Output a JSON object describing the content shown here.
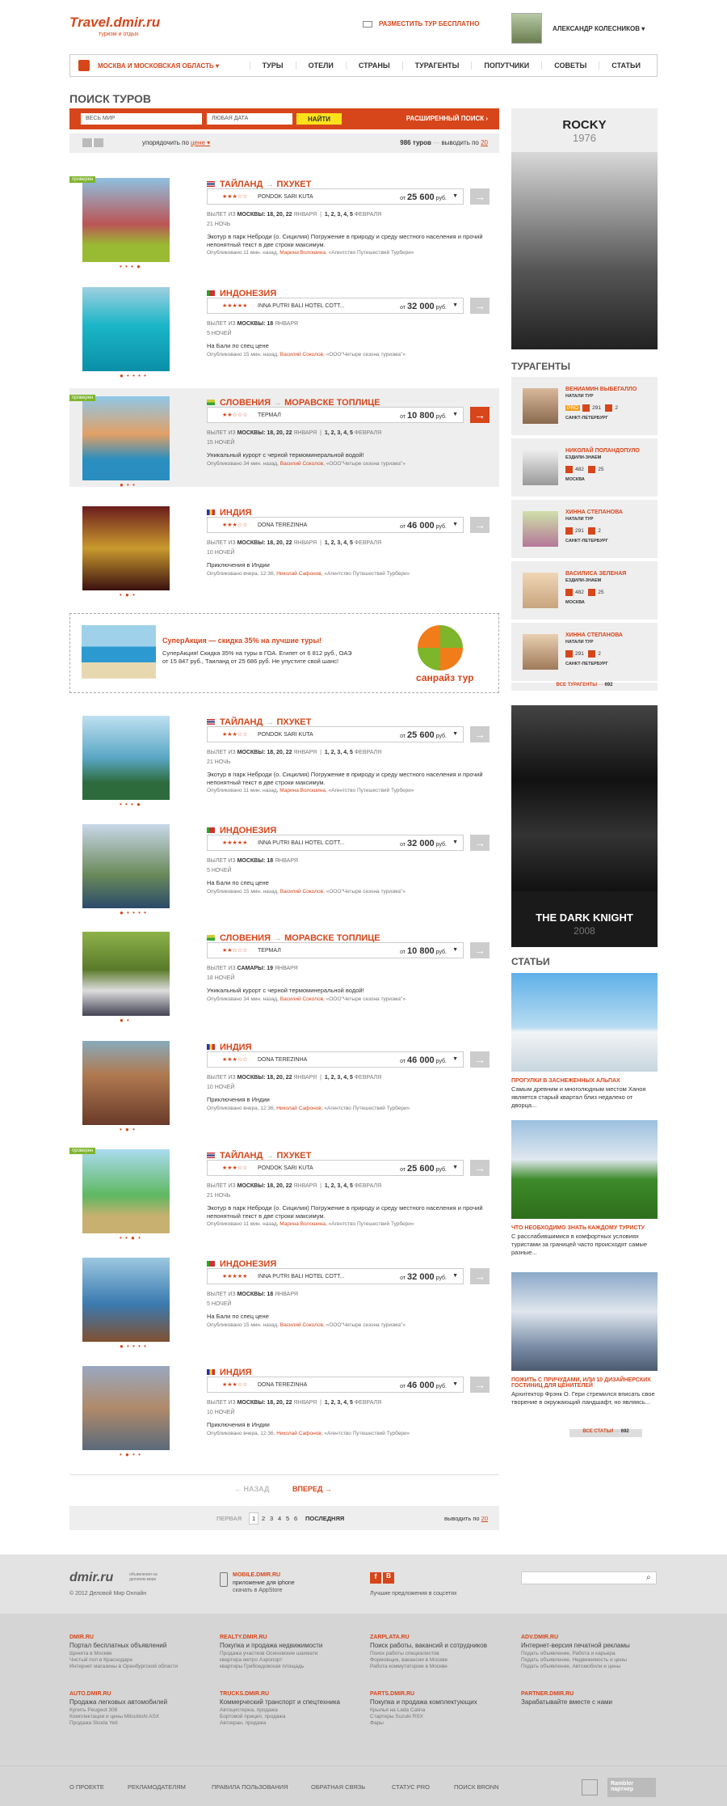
{
  "header": {
    "logo": "Travel.dmir.ru",
    "slogan": "туризм и отдых",
    "place_tour": "РАЗМЕСТИТЬ ТУР БЕСПЛАТНО",
    "user_name": "АЛЕКСАНДР КОЛЕСНИКОВ ▾"
  },
  "nav": {
    "region": "МОСКВА И МОСКОВСКАЯ ОБЛАСТЬ ▾",
    "items": [
      "ТУРЫ",
      "ОТЕЛИ",
      "СТРАНЫ",
      "ТУРАГЕНТЫ",
      "ПОПУТЧИКИ",
      "СОВЕТЫ",
      "СТАТЬИ"
    ]
  },
  "search": {
    "title": "ПОИСК ТУРОВ",
    "where": "ВЕСЬ МИР",
    "date": "ЛЮБАЯ ДАТА",
    "find": "НАЙТИ",
    "advanced": "РАСШИРЕННЫЙ ПОИСК ›",
    "sort_label": "упорядочить по",
    "sort_value": "цене ▾",
    "count": "986 туров",
    "per_page_label": "выводить по",
    "per_page": "20"
  },
  "tours": [
    {
      "badge": "проверен",
      "dots": "• • • ●",
      "country": "ТАЙЛАНД",
      "city": "ПХУКЕТ",
      "stars": "★★★☆☆",
      "hotel": "PONDOK SARI KUTA",
      "price_from": "от",
      "price": "25 600",
      "cur": "руб.",
      "dep_label": "ВЫЛЕТ ИЗ",
      "dep_city": "МОСКВЫ:",
      "dep_jan": "18, 20, 22",
      "jan": "ЯНВАРЯ",
      "dep_feb": "1, 2, 3, 4, 5",
      "feb": "ФЕВРАЛЯ",
      "nights": "21 НОЧЬ",
      "desc": "Экотур в парк Неброди (о. Сицилия) Погружение в природу и среду местного населения и прочий непонятный текст в две строки максимум.",
      "pub": "Опубликовано 11 мин. назад,",
      "author": "Марина Волошина,",
      "agency": "«Агентство Путешествий Турбери»"
    },
    {
      "badge": "",
      "dots": "● • • • •",
      "country": "ИНДОНЕЗИЯ",
      "city": "",
      "stars": "★★★★★",
      "hotel": "INNA PUTRI BALI HOTEL COTT...",
      "price_from": "от",
      "price": "32 000",
      "cur": "руб.",
      "dep_label": "ВЫЛЕТ ИЗ",
      "dep_city": "МОСКВЫ:",
      "dep_jan": "18",
      "jan": "ЯНВАРЯ",
      "dep_feb": "",
      "feb": "",
      "nights": "5 НОЧЕЙ",
      "desc": "На Бали по спец цене",
      "pub": "Опубликовано 15 мин. назад,",
      "author": "Василий Соколов,",
      "agency": "«ООО\"Четыре сезона туризма\"»"
    },
    {
      "badge": "проверен",
      "dots": "● • •",
      "country": "СЛОВЕНИЯ",
      "city": "МОРАВСКЕ ТОПЛИЦЕ",
      "stars": "★★☆☆☆",
      "hotel": "ТЕРМАЛ",
      "price_from": "от",
      "price": "10 800",
      "cur": "руб.",
      "dep_label": "ВЫЛЕТ ИЗ",
      "dep_city": "МОСКВЫ:",
      "dep_jan": "18, 20, 22",
      "jan": "ЯНВАРЯ",
      "dep_feb": "1, 2, 3, 4, 5",
      "feb": "ФЕВРАЛЯ",
      "nights": "15 НОЧЕЙ",
      "desc": "Уникальный курорт с черной термоминеральной водой!",
      "pub": "Опубликовано 34 мин. назад,",
      "author": "Василий Соколов,",
      "agency": "«ООО\"Четыре сезона туризма\"»"
    },
    {
      "badge": "",
      "dots": "• ● •",
      "country": "ИНДИЯ",
      "city": "",
      "stars": "★★★☆☆",
      "hotel": "DONA TEREZINHA",
      "price_from": "от",
      "price": "46 000",
      "cur": "руб.",
      "dep_label": "ВЫЛЕТ ИЗ",
      "dep_city": "МОСКВЫ:",
      "dep_jan": "18, 20, 22",
      "jan": "ЯНВАРЯ",
      "dep_feb": "1, 2, 3, 4, 5",
      "feb": "ФЕВРАЛЯ",
      "nights": "10 НОЧЕЙ",
      "desc": "Приключения в Индии",
      "pub": "Опубликовано вчера, 12:36,",
      "author": "Николай Сафонов,",
      "agency": "«Агентство Путешествий Турбери»"
    },
    {
      "badge": "",
      "dots": "• • • ●",
      "country": "ТАЙЛАНД",
      "city": "ПХУКЕТ",
      "stars": "★★★☆☆",
      "hotel": "PONDOK SARI KUTA",
      "price_from": "от",
      "price": "25 600",
      "cur": "руб.",
      "dep_label": "ВЫЛЕТ ИЗ",
      "dep_city": "МОСКВЫ:",
      "dep_jan": "18, 20, 22",
      "jan": "ЯНВАРЯ",
      "dep_feb": "1, 2, 3, 4, 5",
      "feb": "ФЕВРАЛЯ",
      "nights": "21 НОЧЬ",
      "desc": "Экотур в парк Неброди (о. Сицилия) Погружение в природу и среду местного населения и прочий непонятный текст в две строки максимум.",
      "pub": "Опубликовано 11 мин. назад,",
      "author": "Марина Волошина,",
      "agency": "«Агентство Путешествий Турбери»"
    },
    {
      "badge": "",
      "dots": "● • • • •",
      "country": "ИНДОНЕЗИЯ",
      "city": "",
      "stars": "★★★★★",
      "hotel": "INNA PUTRI BALI HOTEL COTT...",
      "price_from": "от",
      "price": "32 000",
      "cur": "руб.",
      "dep_label": "ВЫЛЕТ ИЗ",
      "dep_city": "МОСКВЫ:",
      "dep_jan": "18",
      "jan": "ЯНВАРЯ",
      "dep_feb": "",
      "feb": "",
      "nights": "5 НОЧЕЙ",
      "desc": "На Бали по спец цене",
      "pub": "Опубликовано 15 мин. назад,",
      "author": "Василий Соколов,",
      "agency": "«ООО\"Четыре сезона туризма\"»"
    },
    {
      "badge": "",
      "dots": "● •",
      "country": "СЛОВЕНИЯ",
      "city": "МОРАВСКЕ ТОПЛИЦЕ",
      "stars": "★★☆☆☆",
      "hotel": "ТЕРМАЛ",
      "price_from": "от",
      "price": "10 800",
      "cur": "руб.",
      "dep_label": "ВЫЛЕТ ИЗ",
      "dep_city": "САМАРЫ:",
      "dep_jan": "19",
      "jan": "ЯНВАРЯ",
      "dep_feb": "",
      "feb": "",
      "nights": "18 НОЧЕЙ",
      "desc": "Уникальный курорт с черной термоминеральной водой!",
      "pub": "Опубликовано 34 мин. назад,",
      "author": "Василий Соколов,",
      "agency": "«ООО\"Четыре сезона туризма\"»"
    },
    {
      "badge": "",
      "dots": "• ● •",
      "country": "ИНДИЯ",
      "city": "",
      "stars": "★★★☆☆",
      "hotel": "DONA TEREZINHA",
      "price_from": "от",
      "price": "46 000",
      "cur": "руб.",
      "dep_label": "ВЫЛЕТ ИЗ",
      "dep_city": "МОСКВЫ:",
      "dep_jan": "18, 20, 22",
      "jan": "ЯНВАРЯ",
      "dep_feb": "1, 2, 3, 4, 5",
      "feb": "ФЕВРАЛЯ",
      "nights": "10 НОЧЕЙ",
      "desc": "Приключения в Индии",
      "pub": "Опубликовано вчера, 12:36,",
      "author": "Николай Сафонов,",
      "agency": "«Агентство Путешествий Турбери»"
    },
    {
      "badge": "проверен",
      "dots": "• • ● •",
      "country": "ТАЙЛАНД",
      "city": "ПХУКЕТ",
      "stars": "★★★☆☆",
      "hotel": "PONDOK SARI KUTA",
      "price_from": "от",
      "price": "25 600",
      "cur": "руб.",
      "dep_label": "ВЫЛЕТ ИЗ",
      "dep_city": "МОСКВЫ:",
      "dep_jan": "18, 20, 22",
      "jan": "ЯНВАРЯ",
      "dep_feb": "1, 2, 3, 4, 5",
      "feb": "ФЕВРАЛЯ",
      "nights": "21 НОЧЬ",
      "desc": "Экотур в парк Неброди (о. Сицилия) Погружение в природу и среду местного населения и прочий непонятный текст в две строки максимум.",
      "pub": "Опубликовано 11 мин. назад,",
      "author": "Марина Волошина,",
      "agency": "«Агентство Путешествий Турбери»"
    },
    {
      "badge": "",
      "dots": "● • • • •",
      "country": "ИНДОНЕЗИЯ",
      "city": "",
      "stars": "★★★★★",
      "hotel": "INNA PUTRI BALI HOTEL COTT...",
      "price_from": "от",
      "price": "32 000",
      "cur": "руб.",
      "dep_label": "ВЫЛЕТ ИЗ",
      "dep_city": "МОСКВЫ:",
      "dep_jan": "18",
      "jan": "ЯНВАРЯ",
      "dep_feb": "",
      "feb": "",
      "nights": "5 НОЧЕЙ",
      "desc": "На Бали по спец цене",
      "pub": "Опубликовано 15 мин. назад,",
      "author": "Василий Соколов,",
      "agency": "«ООО\"Четыре сезона туризма\"»"
    },
    {
      "badge": "",
      "dots": "• ● • •",
      "country": "ИНДИЯ",
      "city": "",
      "stars": "★★★☆☆",
      "hotel": "DONA TEREZINHA",
      "price_from": "от",
      "price": "46 000",
      "cur": "руб.",
      "dep_label": "ВЫЛЕТ ИЗ",
      "dep_city": "МОСКВЫ:",
      "dep_jan": "18, 20, 22",
      "jan": "ЯНВАРЯ",
      "dep_feb": "1, 2, 3, 4, 5",
      "feb": "ФЕВРАЛЯ",
      "nights": "10 НОЧЕЙ",
      "desc": "Приключения в Индии",
      "pub": "Опубликовано вчера, 12:36,",
      "author": "Николай Сафонов,",
      "agency": "«Агентство Путешествий Турбери»"
    }
  ],
  "promo": {
    "title": "СуперАкция — скидка 35% на лучшие туры!",
    "text": "СуперАкция! Скидка 35% на туры в ГОА. Египет от 6 812 руб., ОАЭ от 15 847 руб., Таиланд от 25 686 руб. Не упустите свой шанс!",
    "logo": "санрайз тур"
  },
  "pager": {
    "back": "← НАЗАД",
    "forward": "ВПЕРЕД →",
    "first": "ПЕРВАЯ",
    "pages": [
      "1",
      "2",
      "3",
      "4",
      "5",
      "6"
    ],
    "last": "ПОСЛЕДНЯЯ",
    "per_page_label": "выводить по",
    "per_page": "20"
  },
  "sidebar": {
    "poster1": {
      "title": "ROCKY",
      "year": "1976"
    },
    "agents_title": "ТУРАГЕНТЫ",
    "agents": [
      {
        "name": "ВЕНИАМИН ВЫБЕГАЛЛО",
        "company": "НАТАЛИ ТУР",
        "pro": "PRO",
        "n1": "291",
        "n2": "2",
        "city": "САНКТ-ПЕТЕРБУРГ"
      },
      {
        "name": "НИКОЛАЙ ПОЛАНДОПУЛО",
        "company": "ЕЗДИЛИ-ЗНАЕМ",
        "pro": "",
        "n1": "482",
        "n2": "25",
        "city": "МОСКВА"
      },
      {
        "name": "ХИННА СТЕПАНОВА",
        "company": "НАТАЛИ ТУР",
        "pro": "",
        "n1": "291",
        "n2": "2",
        "city": "САНКТ-ПЕТЕРБУРГ"
      },
      {
        "name": "ВАСИЛИСА ЗЕЛЕНАЯ",
        "company": "ЕЗДИЛИ-ЗНАЕМ",
        "pro": "",
        "n1": "482",
        "n2": "25",
        "city": "МОСКВА"
      },
      {
        "name": "ХИННА СТЕПАНОВА",
        "company": "НАТАЛИ ТУР",
        "pro": "",
        "n1": "291",
        "n2": "2",
        "city": "САНКТ-ПЕТЕРБУРГ"
      }
    ],
    "all_agents": "ВСЕ ТУРАГЕНТЫ",
    "all_agents_count": "692",
    "poster2": {
      "title": "THE DARK KNIGHT",
      "year": "2008"
    },
    "articles_title": "СТАТЬИ",
    "articles": [
      {
        "title": "ПРОГУЛКИ В ЗАСНЕЖЕННЫХ АЛЬПАХ",
        "text": "Самым древним и многолюдным местом Ханоя является старый квартал близ недалеко от дворца..."
      },
      {
        "title": "ЧТО НЕОБХОДИМО ЗНАТЬ КАЖДОМУ ТУРИСТУ",
        "text": "С расслабившимися в комфортных условиях туристами за границей часто происходят самые разные..."
      },
      {
        "title": "ПОЖИТЬ С ПРИЧУДАМИ, ИЛИ 10 ДИЗАЙНЕРСКИХ ГОСТИНИЦ ДЛЯ ЦЕНИТЕЛЕЙ",
        "text": "Архитектор Фрэнк О. Гери стремился вписать свое творение в окружающий ландшафт, но являясь..."
      }
    ],
    "all_articles": "ВСЕ СТАТЬИ",
    "all_articles_count": "692"
  },
  "footer": {
    "logo": "dmir.ru",
    "logo_sub": "объявления на деловом мире",
    "copyright": "© 2012 Деловой Мир Онлайн",
    "app_title": "MOBILE.DMIR.RU",
    "app_text": "приложение для iphone",
    "app_link": "скачать в AppStore",
    "social_text": "Лучшие предложения в соцсетях",
    "cols": [
      {
        "t": "DMIR.RU",
        "h": "Портал бесплатных объявлений",
        "s": "Щенята в Москве\nЧистый пол в Краснодаре\nИнтернет магазины в Оренбургской области"
      },
      {
        "t": "REALTY.DMIR.RU",
        "h": "Покупка и продажа недвижимости",
        "s": "Продажа участков Осиновские шахмати\nквартира метро Аэропорт\nквартиры Грибоедовская площадь"
      },
      {
        "t": "ZARPLATA.RU",
        "h": "Поиск работы, вакансий и сотрудников",
        "s": "Поиск работы специалистов\nФормовщик, вакансии в Москве\nРабота коммутатором в Москве"
      },
      {
        "t": "ADV.DMIR.RU",
        "h": "Интернет-версия печатной рекламы",
        "s": "Подать объявление, Работа и карьера\nПодать объявление, Недвижимость и цены\nПодать объявление, Автомобили и цены"
      },
      {
        "t": "AUTO.DMIR.RU",
        "h": "Продажа легковых автомобилей",
        "s": "Купить Peugeot 308\nКомплектации и цены Mitsubishi ASX\nПродажа Skoda Yeti"
      },
      {
        "t": "TRUCKS.DMIR.RU",
        "h": "Коммерческий транспорт и спецтехника",
        "s": "Автоцистерна, продажа\nБортовой прицеп, продажа\nАвтокран, продажа"
      },
      {
        "t": "PARTS.DMIR.RU",
        "h": "Покупка и продажа комплектующих",
        "s": "Крылья на Lada Calina\nСтартеры Suzuki RSX\nФары"
      },
      {
        "t": "PARTNER.DMIR.RU",
        "h": "Зарабатывайте вместе с нами",
        "s": ""
      }
    ],
    "bottom": [
      "О ПРОЕКТЕ",
      "РЕКЛАМОДАТЕЛЯМ",
      "ПРАВИЛА ПОЛЬЗОВАНИЯ",
      "ОБРАТНАЯ СВЯЗЬ",
      "СТАТУС PRO",
      "ПОИСК BRONN"
    ],
    "rambler": "Rambler партнер"
  },
  "colors": {
    "accent": "#d7461b",
    "verified": "#7db52b",
    "yellow": "#fce21a"
  }
}
